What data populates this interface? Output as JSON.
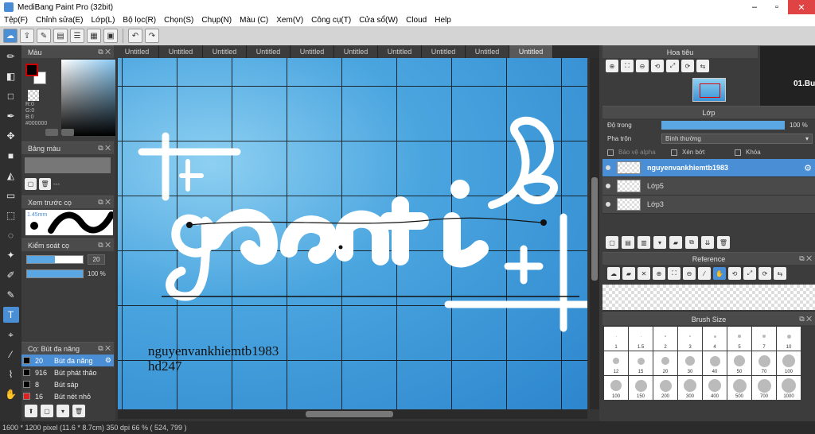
{
  "window": {
    "title": "MediBang Paint Pro (32bit)"
  },
  "menu": [
    "Tệp(F)",
    "Chỉnh sửa(E)",
    "Lớp(L)",
    "Bộ lọc(R)",
    "Chọn(S)",
    "Chụp(N)",
    "Màu (C)",
    "Xem(V)",
    "Công cụ(T)",
    "Cửa sổ(W)",
    "Cloud",
    "Help"
  ],
  "panels": {
    "color": {
      "title": "Màu",
      "r": "R:0",
      "g": "G:0",
      "b": "B:0",
      "hex": "#000000"
    },
    "palette": {
      "title": "Bảng màu",
      "count": "---"
    },
    "preview": {
      "title": "Xem trước cọ",
      "size": "1.45mm"
    },
    "control": {
      "title": "Kiểm soát cọ",
      "size_value": "20",
      "opacity_value": "100 %",
      "size_fraction": 0.5,
      "opacity_fraction": 1.0
    },
    "brush": {
      "title": "Cọ: Bút đa năng",
      "items": [
        {
          "size": "20",
          "name": "Bút đa năng",
          "color": "#000000"
        },
        {
          "size": "916",
          "name": "Bút phát thảo",
          "color": "#000000"
        },
        {
          "size": "8",
          "name": "Bút sáp",
          "color": "#000000"
        },
        {
          "size": "16",
          "name": "Bút nét nhỏ",
          "color": "#e02020"
        }
      ]
    }
  },
  "tabs": [
    "Untitled",
    "Untitled",
    "Untitled",
    "Untitled",
    "Untitled",
    "Untitled",
    "Untitled",
    "Untitled",
    "Untitled",
    "Untitled"
  ],
  "canvas": {
    "signature_line1": "nguyenvankhiemtb1983",
    "signature_line2": "hd247"
  },
  "navigator": {
    "title": "Hoa tiêu",
    "tab_title": "01.Bu"
  },
  "layer": {
    "title": "Lớp",
    "opacity_label": "Độ trong",
    "opacity_value": "100 %",
    "blend_label": "Pha trộn",
    "blend_value": "Bình thường",
    "protect_alpha": "Bảo vệ alpha",
    "clipping": "Xén bớt",
    "lock": "Khóa",
    "items": [
      {
        "name": "nguyenvankhiemtb1983",
        "active": true
      },
      {
        "name": "Lớp5",
        "active": false
      },
      {
        "name": "Lớp3",
        "active": false
      }
    ]
  },
  "reference": {
    "title": "Reference"
  },
  "brush_size": {
    "title": "Brush Size",
    "sizes": [
      "1",
      "1.5",
      "2",
      "3",
      "4",
      "5",
      "7",
      "10",
      "12",
      "15",
      "20",
      "30",
      "40",
      "50",
      "70",
      "100",
      "100",
      "150",
      "200",
      "300",
      "400",
      "500",
      "700",
      "1000"
    ]
  },
  "status": "1600 * 1200 pixel   (11.6 * 8.7cm)   350 dpi   66 %   ( 524, 799 )",
  "colors": {
    "accent": "#4a8fd6",
    "canvas_blue": "#3d9ddd",
    "close": "#e04343"
  }
}
